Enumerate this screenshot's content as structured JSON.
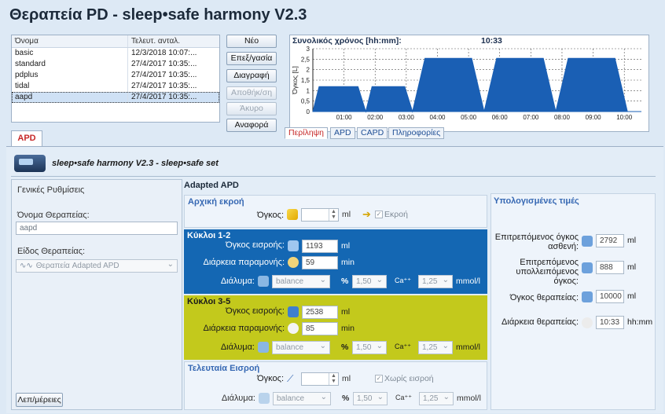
{
  "title": "Θεραπεία PD - sleep•safe harmony V2.3",
  "therapy_list": {
    "col_name": "Όνομα",
    "col_modified": "Τελευτ. ανταλ.",
    "rows": [
      {
        "name": "basic",
        "date": "12/3/2018 10:07:..."
      },
      {
        "name": "standard",
        "date": "27/4/2017 10:35:..."
      },
      {
        "name": "pdplus",
        "date": "27/4/2017 10:35:..."
      },
      {
        "name": "tidal",
        "date": "27/4/2017 10:35:..."
      },
      {
        "name": "aapd",
        "date": "27/4/2017 10:35:..."
      }
    ],
    "selected_index": 4
  },
  "buttons": {
    "new": "Νέο",
    "edit": "Επεξ/γασία",
    "delete": "Διαγραφή",
    "save": "Αποθήκ/ση",
    "cancel": "Άκυρο",
    "report": "Αναφορά"
  },
  "chart_header": {
    "label": "Συνολικός χρόνος [hh:mm]:",
    "value": "10:33"
  },
  "chart_tabs": [
    "Περίληψη",
    "APD",
    "CAPD",
    "Πληροφορίες"
  ],
  "chart_data": {
    "type": "area",
    "ylabel": "Όγκος [L]",
    "xlabel": "",
    "ylim": [
      0,
      3
    ],
    "yticks": [
      "0",
      "0,5",
      "1",
      "1,5",
      "2",
      "2,5",
      "3"
    ],
    "xticks": [
      "01:00",
      "02:00",
      "03:00",
      "04:00",
      "05:00",
      "06:00",
      "07:00",
      "08:00",
      "09:00",
      "10:00"
    ],
    "x": [
      0,
      0.2,
      1.45,
      1.7,
      1.9,
      2.95,
      3.2,
      3.6,
      5.1,
      5.5,
      5.9,
      7.4,
      7.8,
      8.2,
      9.7,
      10.1,
      10.55
    ],
    "y": [
      0,
      1.19,
      1.19,
      0,
      1.19,
      1.19,
      0,
      2.54,
      2.54,
      0,
      2.54,
      2.54,
      0,
      2.54,
      2.54,
      0,
      0
    ],
    "fill_color": "#1a5fb4",
    "grid": true
  },
  "main_tab": "APD",
  "device_line": "sleep•safe harmony V2.3 - sleep•safe set",
  "general": {
    "title": "Γενικές Ρυθμίσεις",
    "name_label": "Όνομα Θεραπείας:",
    "name_value": "aapd",
    "type_label": "Είδος Θεραπείας:",
    "type_value": "Θεραπεία Adapted APD",
    "details_button": "Λεπ/μέρειες"
  },
  "adapted": {
    "header": "Adapted APD",
    "initial_drain": {
      "title": "Αρχική εκροή",
      "volume_label": "Όγκος:",
      "volume_unit": "ml",
      "drain_check": "Εκροή"
    },
    "cycles_1_2": {
      "title": "Κύκλοι 1-2",
      "inflow_label": "Όγκος εισροής:",
      "inflow_value": "1193",
      "inflow_unit": "ml",
      "dwell_label": "Διάρκεια παραμονής:",
      "dwell_value": "59",
      "dwell_unit": "min",
      "solution_label": "Διάλυμα:",
      "solution_value": "balance",
      "pct_label": "%",
      "pct_value": "1,50",
      "ca_label": "Ca⁺⁺",
      "ca_value": "1,25",
      "ca_unit": "mmol/l",
      "color": "#1467b3"
    },
    "cycles_3_5": {
      "title": "Κύκλοι 3-5",
      "inflow_label": "Όγκος εισροής:",
      "inflow_value": "2538",
      "inflow_unit": "ml",
      "dwell_label": "Διάρκεια παραμονής:",
      "dwell_value": "85",
      "dwell_unit": "min",
      "solution_label": "Διάλυμα:",
      "solution_value": "balance",
      "pct_label": "%",
      "pct_value": "1,50",
      "ca_label": "Ca⁺⁺",
      "ca_value": "1,25",
      "ca_unit": "mmol/l",
      "color": "#c3c91c"
    },
    "last_inflow": {
      "title": "Τελευταία Εισροή",
      "volume_label": "Όγκος:",
      "volume_unit": "ml",
      "no_inflow_check": "Χωρίς εισροή",
      "solution_label": "Διάλυμα:",
      "solution_value": "balance",
      "pct_label": "%",
      "pct_value": "1,50",
      "ca_label": "Ca⁺⁺",
      "ca_value": "1,25",
      "ca_unit": "mmol/l"
    }
  },
  "computed": {
    "title": "Υπολογισμένες τιμές",
    "patient_volume_label": "Επιτρεπόμενος όγκος ασθενή:",
    "patient_volume_value": "2792",
    "residual_volume_label": "Επιτρεπόμενος υπολλειπόμενος όγκος:",
    "residual_volume_value": "888",
    "therapy_volume_label": "Όγκος θεραπείας:",
    "therapy_volume_value": "10000",
    "duration_label": "Διάρκεια θεραπείας:",
    "duration_value": "10:33",
    "ml_unit": "ml",
    "time_unit": "hh:mm"
  }
}
